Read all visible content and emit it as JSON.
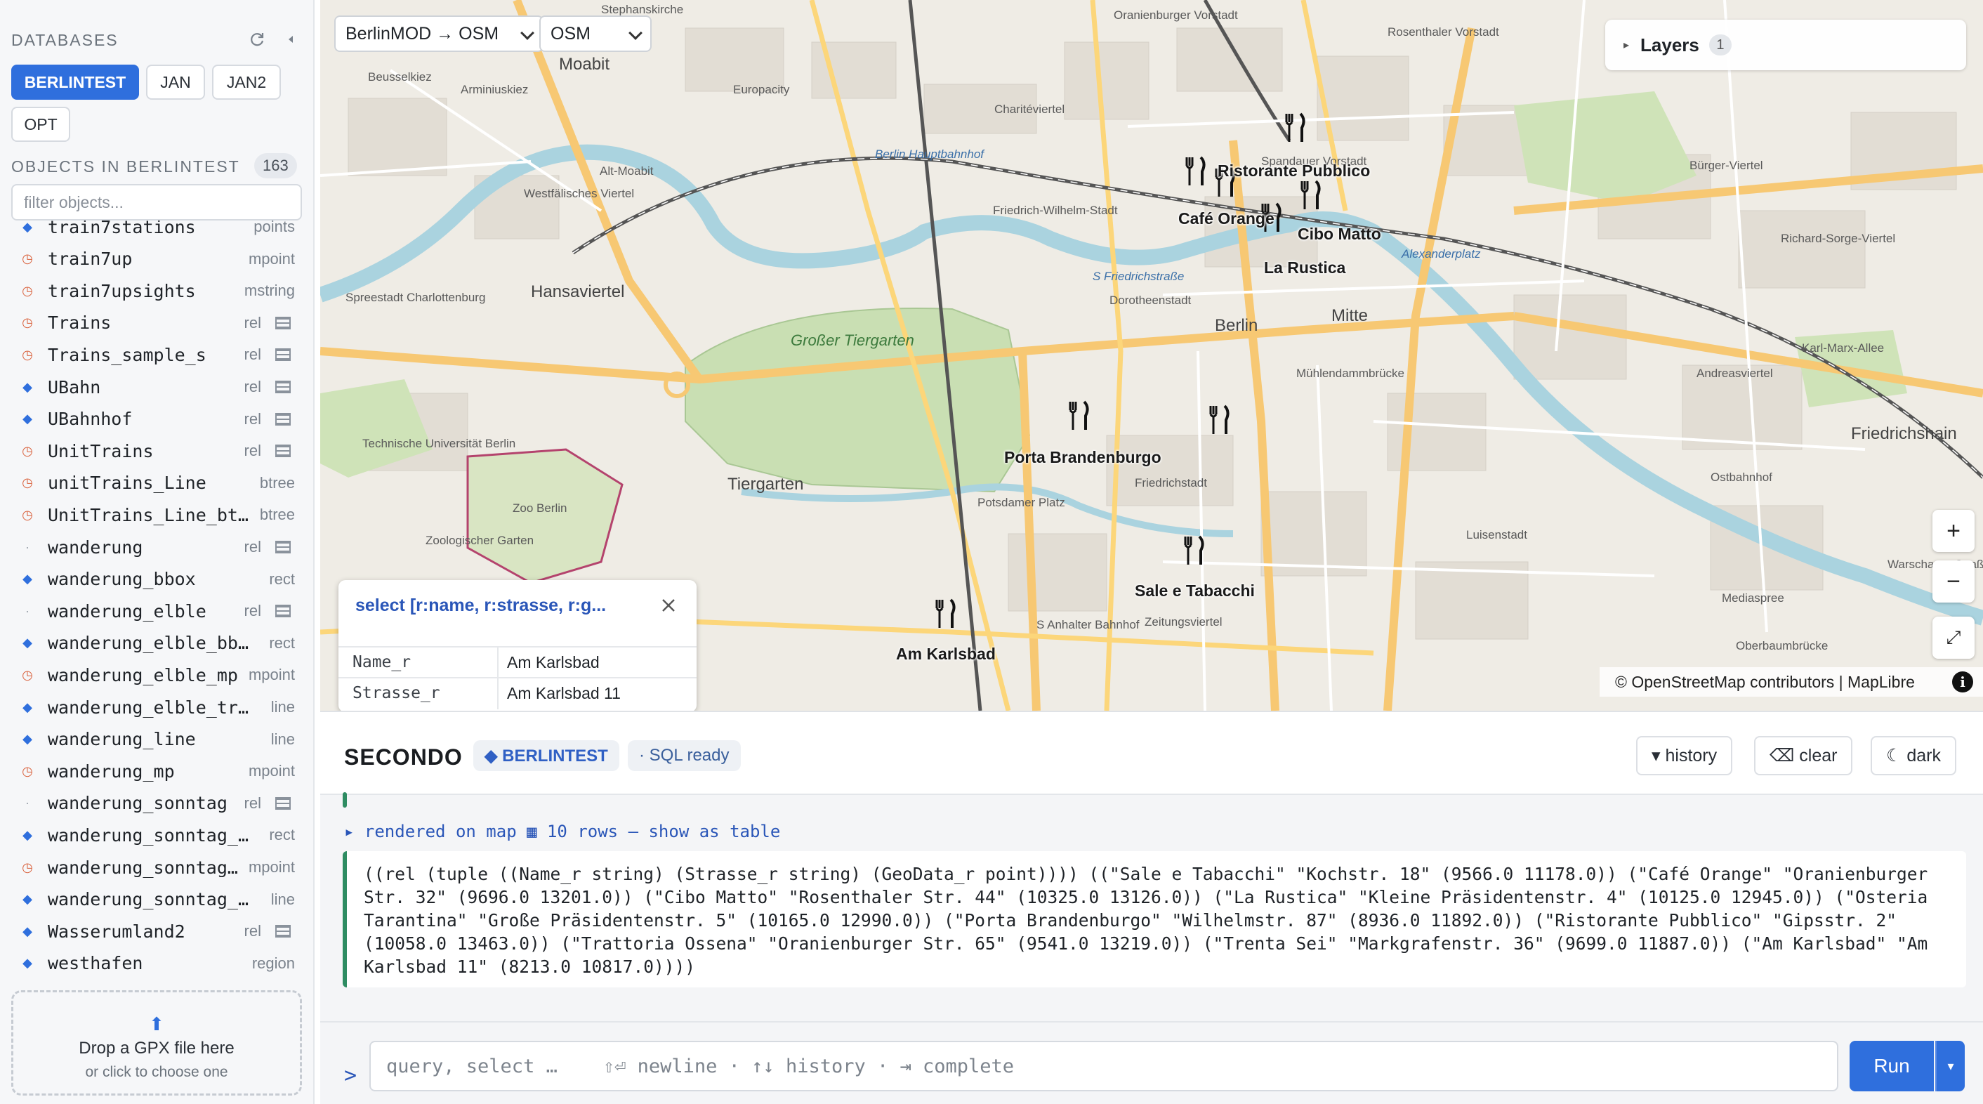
{
  "sidebar": {
    "databases_heading": "DATABASES",
    "databases": [
      {
        "label": "BERLINTEST",
        "active": true
      },
      {
        "label": "JAN",
        "active": false
      },
      {
        "label": "JAN2",
        "active": false
      },
      {
        "label": "OPT",
        "active": false
      }
    ],
    "objects_heading": "OBJECTS IN BERLINTEST",
    "objects_count": "163",
    "filter_placeholder": "filter objects...",
    "objects": [
      {
        "name": "train7stations",
        "type": "points",
        "icon": "diamond",
        "table": false
      },
      {
        "name": "train7up",
        "type": "mpoint",
        "icon": "clock",
        "table": false
      },
      {
        "name": "train7upsights",
        "type": "mstring",
        "icon": "clock",
        "table": false
      },
      {
        "name": "Trains",
        "type": "rel",
        "icon": "clock",
        "table": true
      },
      {
        "name": "Trains_sample_s",
        "type": "rel",
        "icon": "clock",
        "table": true
      },
      {
        "name": "UBahn",
        "type": "rel",
        "icon": "diamond",
        "table": true
      },
      {
        "name": "UBahnhof",
        "type": "rel",
        "icon": "diamond",
        "table": true
      },
      {
        "name": "UnitTrains",
        "type": "rel",
        "icon": "clock",
        "table": true
      },
      {
        "name": "unitTrains_Line",
        "type": "btree",
        "icon": "clock",
        "table": false
      },
      {
        "name": "UnitTrains_Line_bt…",
        "type": "btree",
        "icon": "clock",
        "table": false
      },
      {
        "name": "wanderung",
        "type": "rel",
        "icon": "dot",
        "table": true
      },
      {
        "name": "wanderung_bbox",
        "type": "rect",
        "icon": "diamond",
        "table": false
      },
      {
        "name": "wanderung_elble",
        "type": "rel",
        "icon": "dot",
        "table": true
      },
      {
        "name": "wanderung_elble_bbox",
        "type": "rect",
        "icon": "diamond",
        "table": false
      },
      {
        "name": "wanderung_elble_mp",
        "type": "mpoint",
        "icon": "clock",
        "table": false
      },
      {
        "name": "wanderung_elble_tra…",
        "type": "line",
        "icon": "diamond",
        "table": false
      },
      {
        "name": "wanderung_line",
        "type": "line",
        "icon": "diamond",
        "table": false
      },
      {
        "name": "wanderung_mp",
        "type": "mpoint",
        "icon": "clock",
        "table": false
      },
      {
        "name": "wanderung_sonntag",
        "type": "rel",
        "icon": "dot",
        "table": true
      },
      {
        "name": "wanderung_sonntag_b…",
        "type": "rect",
        "icon": "diamond",
        "table": false
      },
      {
        "name": "wanderung_sonntag…",
        "type": "mpoint",
        "icon": "clock",
        "table": false
      },
      {
        "name": "wanderung_sonntag_t…",
        "type": "line",
        "icon": "diamond",
        "table": false
      },
      {
        "name": "Wasserumland2",
        "type": "rel",
        "icon": "diamond",
        "table": true
      },
      {
        "name": "westhafen",
        "type": "region",
        "icon": "diamond",
        "table": false
      }
    ],
    "dropzone": {
      "arrow": "⬆",
      "title": "Drop a GPX file here",
      "subtitle": "or click to choose one"
    }
  },
  "map": {
    "projection_select": "BerlinMOD → OSM",
    "basemap_select": "OSM",
    "layers_label": "Layers",
    "layers_count": "1",
    "zoom_in": "+",
    "zoom_out": "−",
    "fullscreen": "⤢",
    "attribution": "© OpenStreetMap contributors | MapLibre",
    "attribution_info": "i",
    "pois": [
      {
        "label": "Ristorante Pubblico"
      },
      {
        "label": "Café Orange"
      },
      {
        "label": "Cibo Matto"
      },
      {
        "label": "La Rustica"
      },
      {
        "label": "Porta Brandenburgo"
      },
      {
        "label": "Sale e Tabacchi"
      },
      {
        "label": "Am Karlsbad"
      }
    ],
    "places": [
      "Stephanskirche",
      "Oranienburger Vorstadt",
      "Rosenthaler Vorstadt",
      "Moabit",
      "Beusselkiez",
      "Arminiuskiez",
      "Europacity",
      "Charitéviertel",
      "Spandauer Vorstadt",
      "Berlin Hauptbahnhof",
      "Westfälisches Viertel",
      "Alt-Moabit",
      "Friedrich-Wilhelm-Stadt",
      "S Friedrichstraße",
      "Alexanderplatz",
      "Hansaviertel",
      "Spreestadt Charlottenburg",
      "Dorotheenstadt",
      "Berlin",
      "Mitte",
      "Großer Tiergarten",
      "Tiergarten",
      "Technische Universität Berlin",
      "Mühlendammbrücke",
      "Andreasviertel",
      "Friedrichstadt",
      "Potsdamer Platz",
      "Zoo Berlin",
      "Zoologischer Garten",
      "Luisenstadt",
      "Ostbahnhof",
      "Friedrichshain",
      "Zeitungsviertel",
      "S Anhalter Bahnhof",
      "Mediaspree",
      "Oberbaumbrücke",
      "Richard-Sorge-Viertel",
      "Karl-Marx-Allee",
      "Warschauer Straße",
      "Bürger-Viertel"
    ],
    "popup": {
      "title": "select [r:name, r:strasse, r:g...",
      "rows": [
        {
          "key": "Name_r",
          "value": "Am Karlsbad"
        },
        {
          "key": "Strasse_r",
          "value": "Am Karlsbad 11"
        }
      ]
    }
  },
  "secondo": {
    "title": "SECONDO",
    "db_chip": "◆ BERLINTEST",
    "sql_chip": "· SQL ready",
    "history_button": "▾ history",
    "clear_button": "⌫ clear",
    "dark_button": "☾ dark",
    "rendered_line": "▸ rendered on map  ▦ 10 rows — show as table",
    "result": "((rel (tuple ((Name_r string) (Strasse_r string) (GeoData_r point)))) ((\"Sale e Tabacchi\" \"Kochstr. 18\" (9566.0 11178.0)) (\"Café Orange\" \"Oranienburger Str. 32\" (9696.0 13201.0)) (\"Cibo Matto\" \"Rosenthaler Str. 44\" (10325.0 13126.0)) (\"La Rustica\" \"Kleine Präsidentenstr. 4\" (10125.0 12945.0)) (\"Osteria Tarantina\" \"Große Präsidentenstr. 5\" (10165.0 12990.0)) (\"Porta Brandenburgo\" \"Wilhelmstr. 87\" (8936.0 11892.0)) (\"Ristorante Pubblico\" \"Gipsstr. 2\" (10058.0 13463.0)) (\"Trattoria Ossena\" \"Oranienburger Str. 65\" (9541.0 13219.0)) (\"Trenta Sei\" \"Markgrafenstr. 36\" (9699.0 11887.0)) (\"Am Karlsbad\" \"Am Karlsbad 11\" (8213.0 10817.0))))",
    "prompt": ">",
    "query_placeholder": "query, select …    ⇧⏎ newline · ↑↓ history · ⇥ complete",
    "run_label": "Run",
    "run_menu": "▾"
  },
  "colors": {
    "accent": "#2f6fdd",
    "success": "#2e8c62",
    "popup_title": "#2a56b8"
  }
}
